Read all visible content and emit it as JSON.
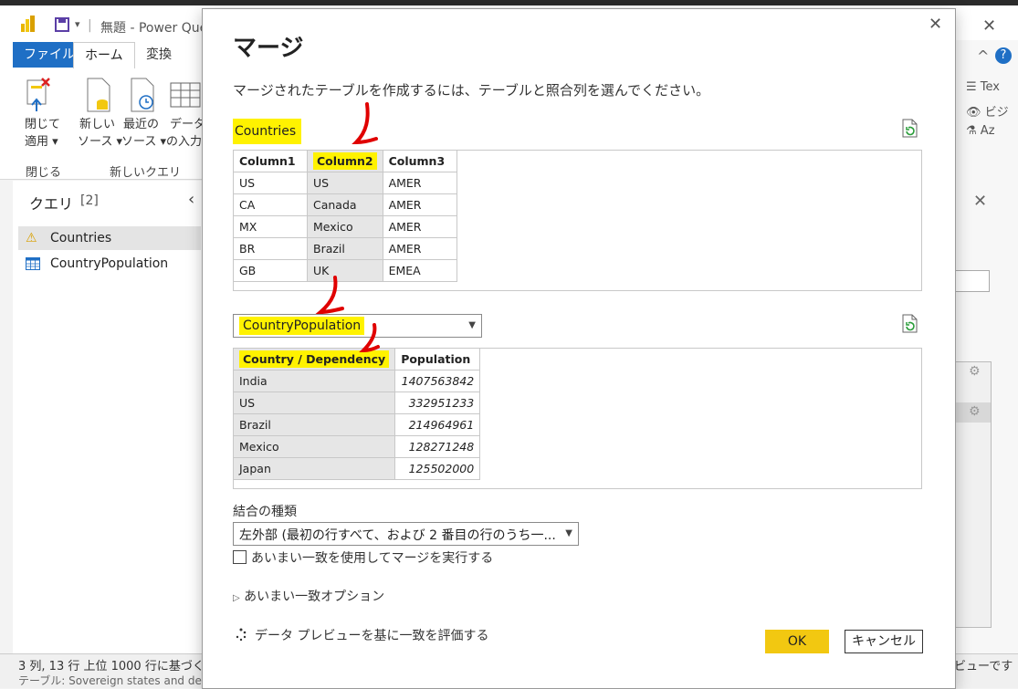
{
  "window": {
    "title": "無題 - Power Que",
    "tabs": {
      "file": "ファイル",
      "home": "ホーム",
      "transform": "変換"
    }
  },
  "ribbon": {
    "close_apply": {
      "line1": "閉じて",
      "line2": "適用 ▾"
    },
    "new_source": {
      "line1": "新しい",
      "line2": "ソース ▾"
    },
    "recent_source": {
      "line1": "最近の",
      "line2": "ソース ▾"
    },
    "enter_data": {
      "line1": "データ",
      "line2": "の入力"
    },
    "group_close": "閉じる",
    "group_new_query": "新しいクエリ"
  },
  "right_ribbon": {
    "text": "Tex",
    "visual": "ビジ",
    "azure": "Az"
  },
  "queries": {
    "header": "クエリ",
    "count": "[2]",
    "items": [
      {
        "name": "Countries",
        "icon": "warning-icon"
      },
      {
        "name": "CountryPopulation",
        "icon": "table-icon"
      }
    ]
  },
  "statusbar": {
    "left": "3 列, 13 行    上位 1000 行に基づく",
    "bottom": "テーブル: Sovereign states and de",
    "right": "ビューです"
  },
  "dialog": {
    "title": "マージ",
    "description": "マージされたテーブルを作成するには、テーブルと照合列を選んでください。",
    "first_table": {
      "name": "Countries",
      "columns": [
        "Column1",
        "Column2",
        "Column3"
      ],
      "selected_column": 1,
      "rows": [
        [
          "US",
          "US",
          "AMER"
        ],
        [
          "CA",
          "Canada",
          "AMER"
        ],
        [
          "MX",
          "Mexico",
          "AMER"
        ],
        [
          "BR",
          "Brazil",
          "AMER"
        ],
        [
          "GB",
          "UK",
          "EMEA"
        ]
      ]
    },
    "second_table": {
      "name": "CountryPopulation",
      "columns": [
        "Country / Dependency",
        "Population"
      ],
      "selected_column": 0,
      "rows": [
        [
          "India",
          "1407563842"
        ],
        [
          "US",
          "332951233"
        ],
        [
          "Brazil",
          "214964961"
        ],
        [
          "Mexico",
          "128271248"
        ],
        [
          "Japan",
          "125502000"
        ]
      ]
    },
    "join_kind_label": "結合の種類",
    "join_kind_value": "左外部 (最初の行すべて、および 2 番目の行のうち一...",
    "fuzzy_checkbox": "あいまい一致を使用してマージを実行する",
    "fuzzy_options": "あいまい一致オプション",
    "evaluate_text": "データ プレビューを基に一致を評価する",
    "ok": "OK",
    "cancel": "キャンセル"
  },
  "colors": {
    "highlight": "#fff200",
    "ok_button": "#f2c811",
    "file_tab": "#1f6fc5",
    "annotation": "#e00000"
  }
}
